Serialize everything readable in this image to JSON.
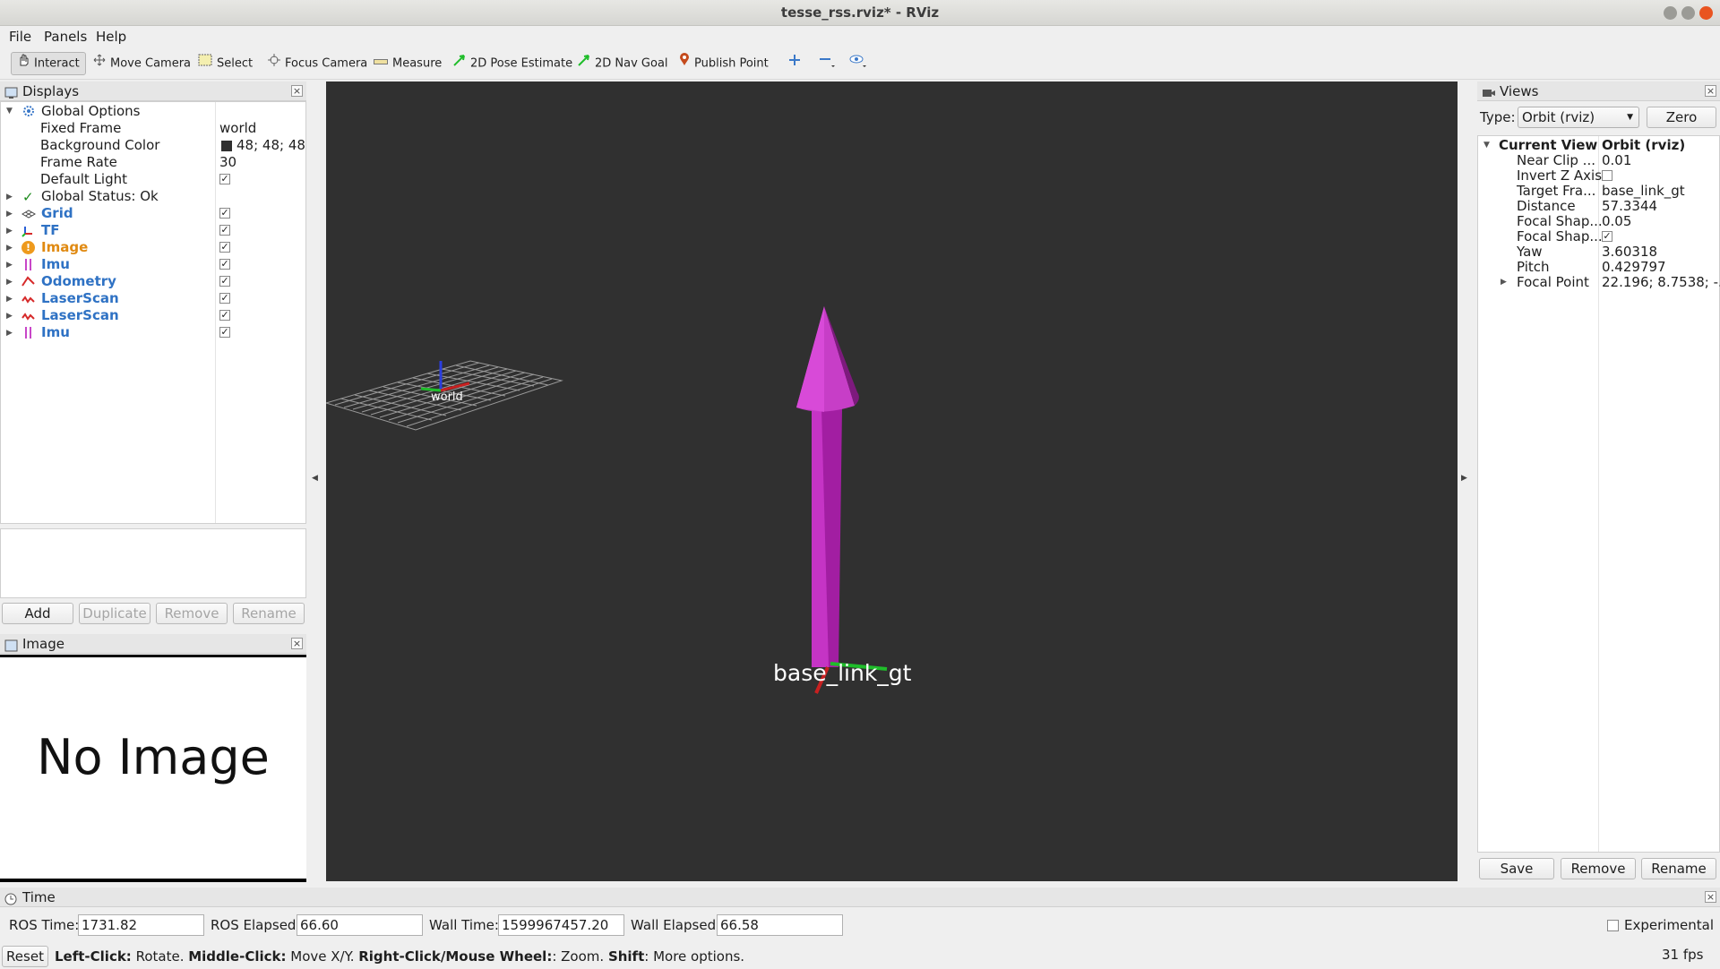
{
  "window": {
    "title": "tesse_rss.rviz* - RViz"
  },
  "menu": [
    "File",
    "Panels",
    "Help"
  ],
  "toolbar": {
    "tools": [
      "Interact",
      "Move Camera",
      "Select",
      "Focus Camera",
      "Measure",
      "2D Pose Estimate",
      "2D Nav Goal",
      "Publish Point"
    ]
  },
  "displays": {
    "title": "Displays",
    "global_options": "Global Options",
    "props": [
      {
        "name": "Fixed Frame",
        "value": "world"
      },
      {
        "name": "Background Color",
        "value": "48; 48; 48"
      },
      {
        "name": "Frame Rate",
        "value": "30"
      },
      {
        "name": "Default Light",
        "value": ""
      }
    ],
    "global_status": "Global Status: Ok",
    "items": [
      {
        "name": "Grid",
        "icon": "grid-icon",
        "checked": true
      },
      {
        "name": "TF",
        "icon": "tf-icon",
        "checked": true
      },
      {
        "name": "Image",
        "icon": "warning-icon",
        "checked": true
      },
      {
        "name": "Imu",
        "icon": "imu-icon",
        "checked": true
      },
      {
        "name": "Odometry",
        "icon": "odometry-icon",
        "checked": true
      },
      {
        "name": "LaserScan",
        "icon": "laserscan-icon",
        "checked": true
      },
      {
        "name": "LaserScan",
        "icon": "laserscan-icon",
        "checked": true
      },
      {
        "name": "Imu",
        "icon": "imu-icon",
        "checked": true
      }
    ],
    "buttons": {
      "add": "Add",
      "duplicate": "Duplicate",
      "remove": "Remove",
      "rename": "Rename"
    }
  },
  "image_panel": {
    "title": "Image",
    "message": "No Image"
  },
  "viewport": {
    "background": "#303030",
    "frame_world": "world",
    "frame_base": "base_link_gt"
  },
  "views": {
    "title": "Views",
    "type_label": "Type:",
    "type_value": "Orbit (rviz)",
    "zero": "Zero",
    "current_view": "Current View",
    "current_view_value": "Orbit (rviz)",
    "props": [
      {
        "name": "Near Clip ...",
        "value": "0.01"
      },
      {
        "name": "Invert Z Axis",
        "value": ""
      },
      {
        "name": "Target Fra...",
        "value": "base_link_gt"
      },
      {
        "name": "Distance",
        "value": "57.3344"
      },
      {
        "name": "Focal Shap...",
        "value": "0.05"
      },
      {
        "name": "Focal Shap...",
        "value": ""
      },
      {
        "name": "Yaw",
        "value": "3.60318"
      },
      {
        "name": "Pitch",
        "value": "0.429797"
      },
      {
        "name": "Focal Point",
        "value": "22.196; 8.7538; -..."
      }
    ],
    "buttons": {
      "save": "Save",
      "remove": "Remove",
      "rename": "Rename"
    }
  },
  "time": {
    "title": "Time",
    "ros_time_label": "ROS Time:",
    "ros_time": "1731.82",
    "ros_elapsed_label": "ROS Elapsed:",
    "ros_elapsed": "66.60",
    "wall_time_label": "Wall Time:",
    "wall_time": "1599967457.20",
    "wall_elapsed_label": "Wall Elapsed:",
    "wall_elapsed": "66.58",
    "experimental": "Experimental"
  },
  "status": {
    "reset": "Reset",
    "left_click_b": "Left-Click:",
    "left_click": " Rotate. ",
    "middle_click_b": "Middle-Click:",
    "middle_click": " Move X/Y. ",
    "right_click_b": "Right-Click/Mouse Wheel:",
    "right_click": ": Zoom. ",
    "shift_b": "Shift",
    "shift": ": More options.",
    "fps": "31 fps"
  }
}
